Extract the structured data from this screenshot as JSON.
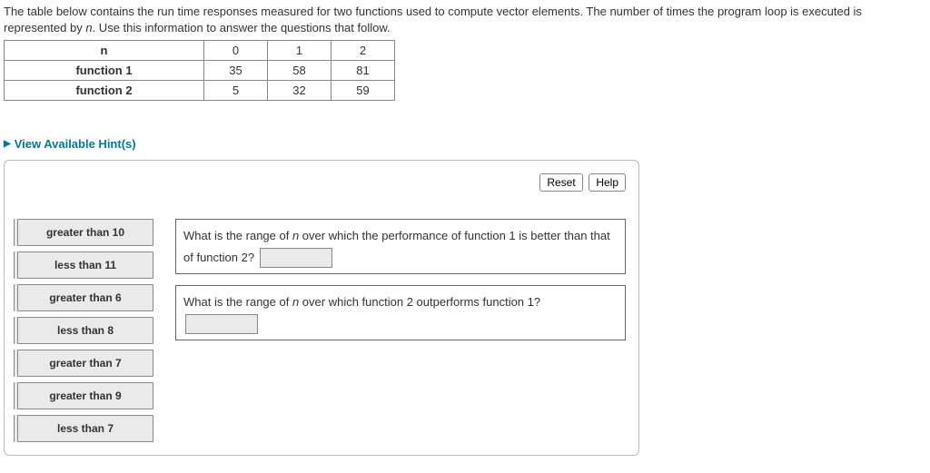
{
  "prompt": {
    "line1_a": "The table below contains the run time responses measured for two functions used to compute vector elements. The number of times the program loop is executed is represented by ",
    "line1_n": "n",
    "line1_b": ". Use this information to answer the questions that follow."
  },
  "table": {
    "header_n": "n",
    "cols": [
      "0",
      "1",
      "2"
    ],
    "rows": [
      {
        "label": "function 1",
        "vals": [
          "35",
          "58",
          "81"
        ]
      },
      {
        "label": "function 2",
        "vals": [
          "5",
          "32",
          "59"
        ]
      }
    ]
  },
  "hints_label": "View Available Hint(s)",
  "buttons": {
    "reset": "Reset",
    "help": "Help"
  },
  "options": [
    "greater than 10",
    "less than 11",
    "greater than 6",
    "less than 8",
    "greater than 7",
    "greater than 9",
    "less than 7"
  ],
  "questions": {
    "q1_a": "What is the range of ",
    "q1_n": "n",
    "q1_b": " over which the performance of function 1 is better than that of function 2?",
    "q2_a": "What is the range of ",
    "q2_n": "n",
    "q2_b": " over which function 2 outperforms function 1?"
  }
}
